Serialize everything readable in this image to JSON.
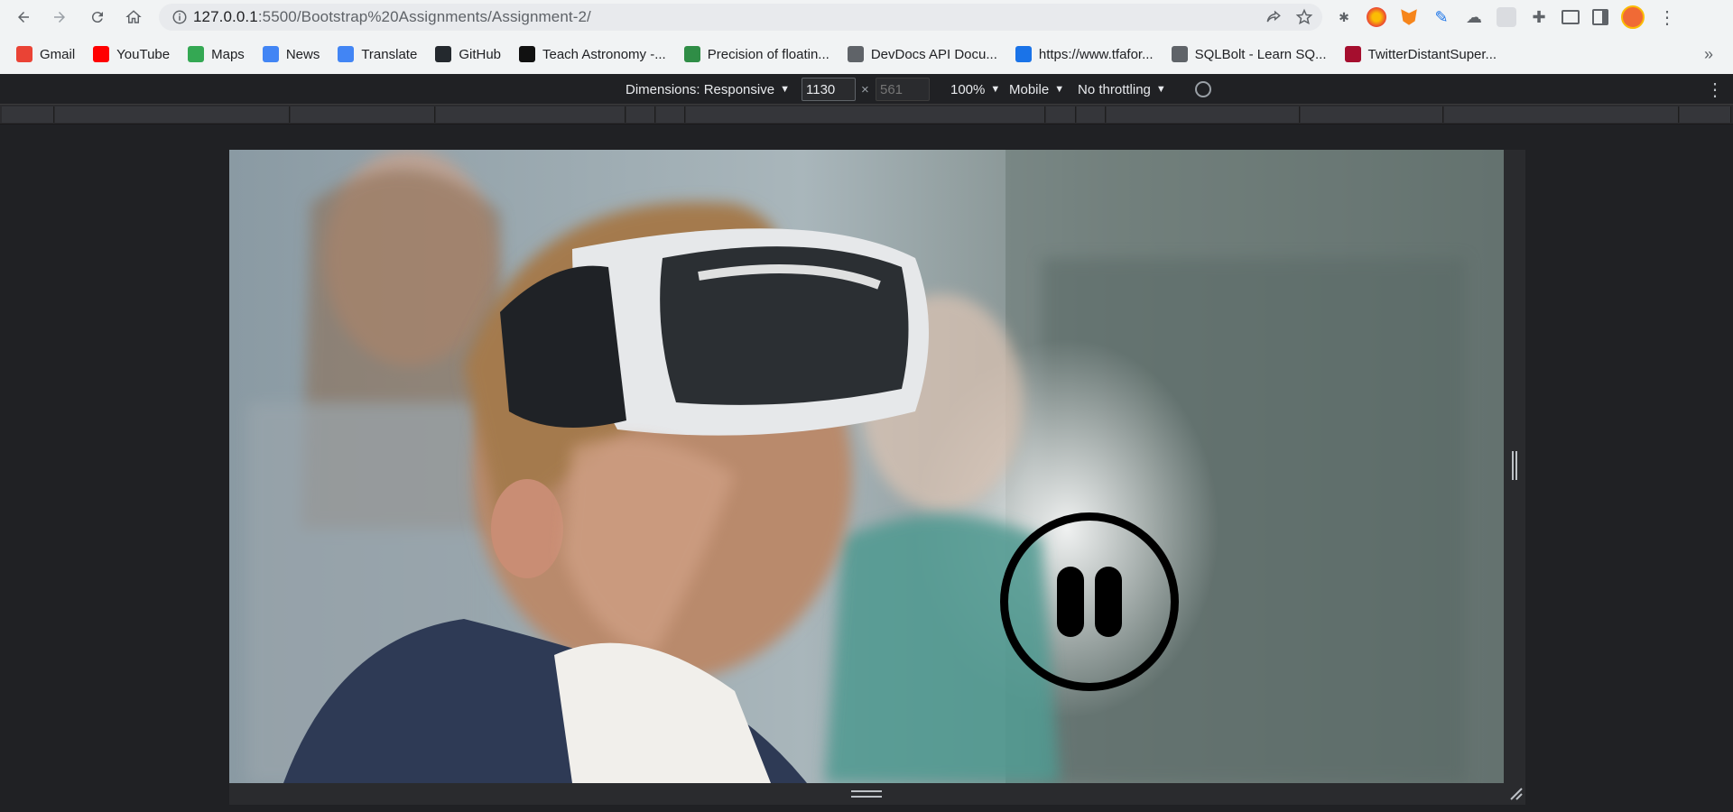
{
  "browser": {
    "url_host": "127.0.0.1",
    "url_rest": ":5500/Bootstrap%20Assignments/Assignment-2/"
  },
  "bookmarks": [
    {
      "label": "Gmail",
      "icon": "gmail-icon",
      "color": "#ea4335"
    },
    {
      "label": "YouTube",
      "icon": "youtube-icon",
      "color": "#ff0000"
    },
    {
      "label": "Maps",
      "icon": "maps-icon",
      "color": "#34a853"
    },
    {
      "label": "News",
      "icon": "news-icon",
      "color": "#4285f4"
    },
    {
      "label": "Translate",
      "icon": "translate-icon",
      "color": "#4285f4"
    },
    {
      "label": "GitHub",
      "icon": "github-icon",
      "color": "#24292e"
    },
    {
      "label": "Teach Astronomy -...",
      "icon": "teach-astronomy-icon",
      "color": "#111111"
    },
    {
      "label": "Precision of floatin...",
      "icon": "geeksforgeeks-icon",
      "color": "#2f8d46"
    },
    {
      "label": "DevDocs API Docu...",
      "icon": "devdocs-icon",
      "color": "#5f6368"
    },
    {
      "label": "https://www.tfafor...",
      "icon": "tfa-icon",
      "color": "#1a73e8"
    },
    {
      "label": "SQLBolt - Learn SQ...",
      "icon": "sqlbolt-icon",
      "color": "#5f6368"
    },
    {
      "label": "TwitterDistantSuper...",
      "icon": "s-icon",
      "color": "#a50e2e"
    }
  ],
  "devtools": {
    "dimensions_label": "Dimensions: Responsive",
    "width_value": "1130",
    "height_placeholder": "561",
    "times": "×",
    "zoom": "100%",
    "device_type": "Mobile",
    "throttling": "No throttling"
  },
  "video": {
    "state": "paused-overlay-visible"
  }
}
